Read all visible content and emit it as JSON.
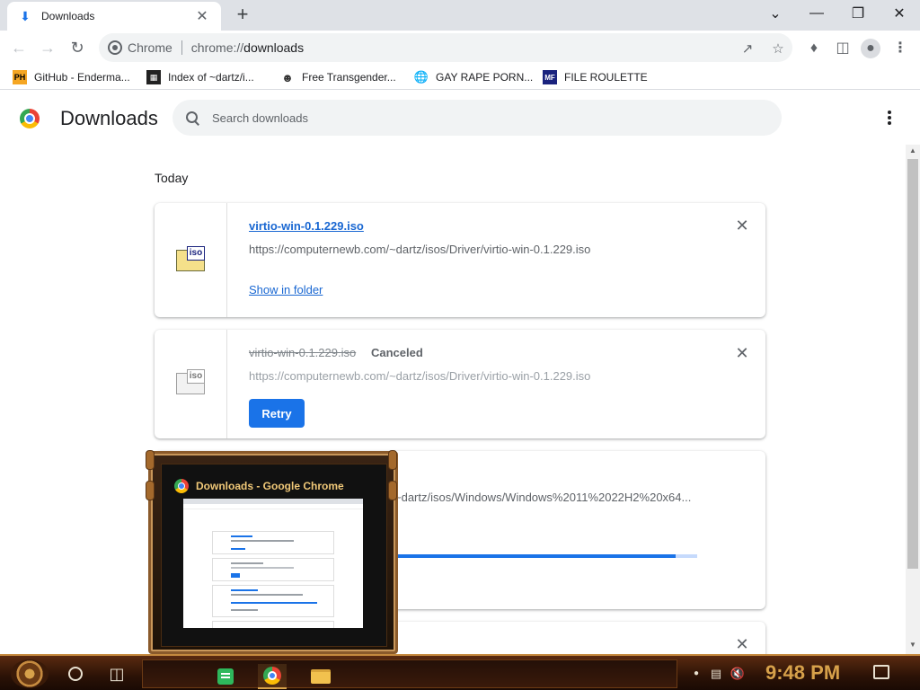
{
  "window": {
    "tab_title": "Downloads",
    "tab_icon": "download-icon",
    "controls": [
      "chevron-down-icon",
      "minimize-icon",
      "restore-icon",
      "close-icon"
    ]
  },
  "toolbar": {
    "site_label": "Chrome",
    "url_scheme": "chrome://",
    "url_host": "downloads"
  },
  "bookmarks": [
    {
      "label": "GitHub - Enderma...",
      "icon": "PH"
    },
    {
      "label": "Index of ~dartz/i...",
      "icon": "index-icon"
    },
    {
      "label": "Free Transgender...",
      "icon": "mask-icon"
    },
    {
      "label": "GAY RAPE PORN...",
      "icon": "globe-icon"
    },
    {
      "label": "FILE ROULETTE",
      "icon": "MF"
    }
  ],
  "downloads_page": {
    "title": "Downloads",
    "search_placeholder": "Search downloads",
    "section_date": "Today",
    "items": [
      {
        "filename": "virtio-win-0.1.229.iso",
        "url": "https://computernewb.com/~dartz/isos/Driver/virtio-win-0.1.229.iso",
        "action": "Show in folder",
        "state": "complete"
      },
      {
        "filename": "virtio-win-0.1.229.iso",
        "status": "Canceled",
        "url": "https://computernewb.com/~dartz/isos/Driver/virtio-win-0.1.229.iso",
        "action": "Retry",
        "state": "canceled"
      },
      {
        "url": "~dartz/isos/Windows/Windows%2011%2022H2%20x64...",
        "state": "in-progress",
        "progress": 0.93
      }
    ]
  },
  "taskbar_preview": {
    "title": "Downloads - Google Chrome"
  },
  "taskbar": {
    "clock": "9:48 PM"
  },
  "colors": {
    "accent": "#1a73e8",
    "link": "#1967d2",
    "taskbar_gold": "#d7a14a"
  }
}
